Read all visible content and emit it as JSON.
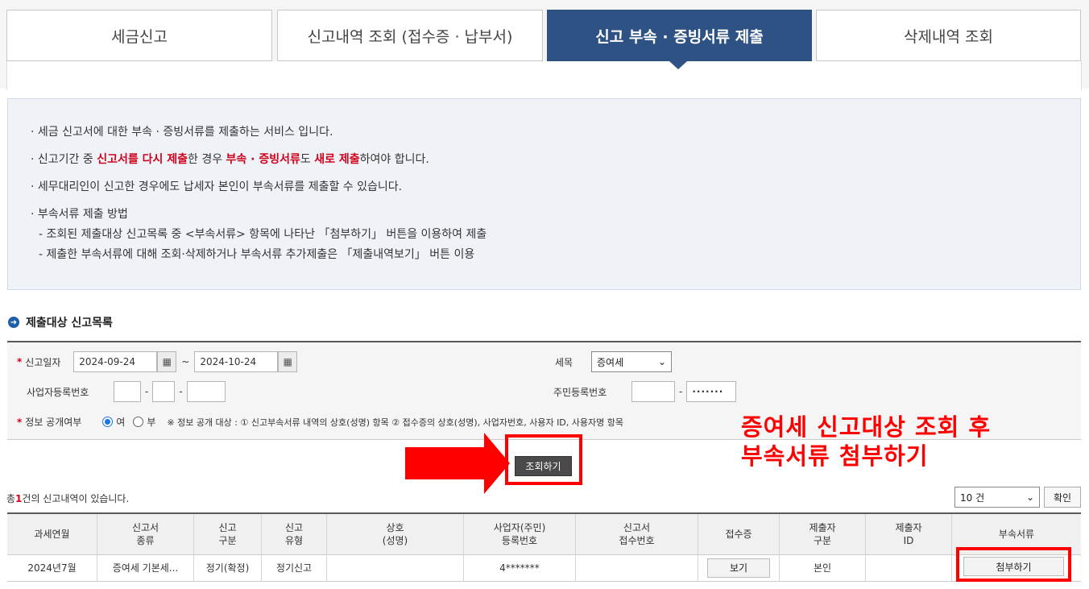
{
  "tabs": [
    {
      "label": "세금신고"
    },
    {
      "label": "신고내역 조회 (접수증 · 납부서)"
    },
    {
      "label": "신고 부속 · 증빙서류 제출"
    },
    {
      "label": "삭제내역 조회"
    }
  ],
  "info": {
    "line1": "· 세금 신고서에 대한 부속 · 증빙서류를 제출하는 서비스 입니다.",
    "line2_a": "· 신고기간 중 ",
    "line2_b": "신고서를 다시 제출",
    "line2_c": "한 경우 ",
    "line2_d": "부속 · 증빙서류",
    "line2_e": "도 ",
    "line2_f": "새로 제출",
    "line2_g": "하여야 합니다.",
    "line3": "· 세무대리인이 신고한 경우에도 납세자 본인이 부속서류를 제출할 수 있습니다.",
    "line4": "· 부속서류 제출 방법",
    "line5": "- 조회된 제출대상 신고목록 중 <부속서류> 항목에 나타난 「첨부하기」 버튼을 이용하여 제출",
    "line6": "- 제출한 부속서류에 대해 조회·삭제하거나 부속서류 추가제출은 「제출내역보기」 버튼 이용"
  },
  "section_title": "제출대상 신고목록",
  "form": {
    "date_label": "신고일자",
    "date_from": "2024-09-24",
    "date_to": "2024-10-24",
    "tilde": "~",
    "tax_label": "세목",
    "tax_value": "증여세",
    "biz_label": "사업자등록번호",
    "resident_label": "주민등록번호",
    "resident_mask": "·······",
    "public_label": "정보 공개여부",
    "radio_yes": "여",
    "radio_no": "부",
    "public_note": "※ 정보 공개 대상 : ① 신고부속서류 내역의 상호(성명) 항목 ② 접수증의 상호(성명), 사업자번호, 사용자 ID, 사용자명 항목",
    "dash": "-"
  },
  "search_button": "조회하기",
  "callout": {
    "line1": "증여세 신고대상 조회 후",
    "line2": "부속서류 첨부하기"
  },
  "count": {
    "prefix": "총",
    "num": "1",
    "suffix": "건의 신고내역이 있습니다."
  },
  "page_size": "10 건",
  "confirm": "확인",
  "table": {
    "headers": [
      {
        "l1": "과세연월",
        "l2": ""
      },
      {
        "l1": "신고서",
        "l2": "종류"
      },
      {
        "l1": "신고",
        "l2": "구분"
      },
      {
        "l1": "신고",
        "l2": "유형"
      },
      {
        "l1": "상호",
        "l2": "(성명)"
      },
      {
        "l1": "사업자(주민)",
        "l2": "등록번호"
      },
      {
        "l1": "신고서",
        "l2": "접수번호"
      },
      {
        "l1": "접수증",
        "l2": ""
      },
      {
        "l1": "제출자",
        "l2": "구분"
      },
      {
        "l1": "제출자",
        "l2": "ID"
      },
      {
        "l1": "부속서류",
        "l2": ""
      }
    ],
    "row": {
      "period": "2024년7월",
      "form_type": "증여세 기본세...",
      "category": "정기(확정)",
      "type": "정기신고",
      "name": "",
      "reg_no": "4*******",
      "receipt_no": "",
      "view_btn": "보기",
      "submitter": "본인",
      "submitter_id": "",
      "attach_btn": "첨부하기"
    }
  },
  "colors": {
    "active_tab": "#2e5283",
    "highlight": "#ff0000",
    "emphasis": "#d0021b"
  }
}
